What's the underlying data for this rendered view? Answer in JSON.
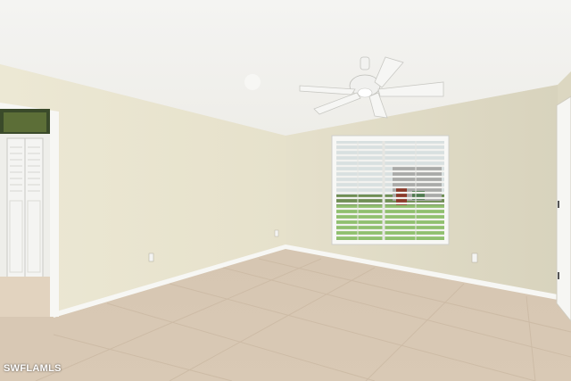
{
  "scene": {
    "description_name": "empty-bedroom-photo",
    "colors": {
      "ceiling": "#f1f1ee",
      "left_wall": "#ebe7d3",
      "back_wall": "#e4dfca",
      "right_wall": "#ddd8c3",
      "floor": "#d9c8b2",
      "baseboard": "#f7f7f4",
      "window_glass": "#c9d4cf",
      "lawn": "#8fbf6e"
    },
    "icons": [
      "ceiling-fan-icon",
      "window-blinds-icon",
      "closet-door-icon"
    ]
  },
  "watermark": {
    "text": "SWFLAMLS"
  }
}
